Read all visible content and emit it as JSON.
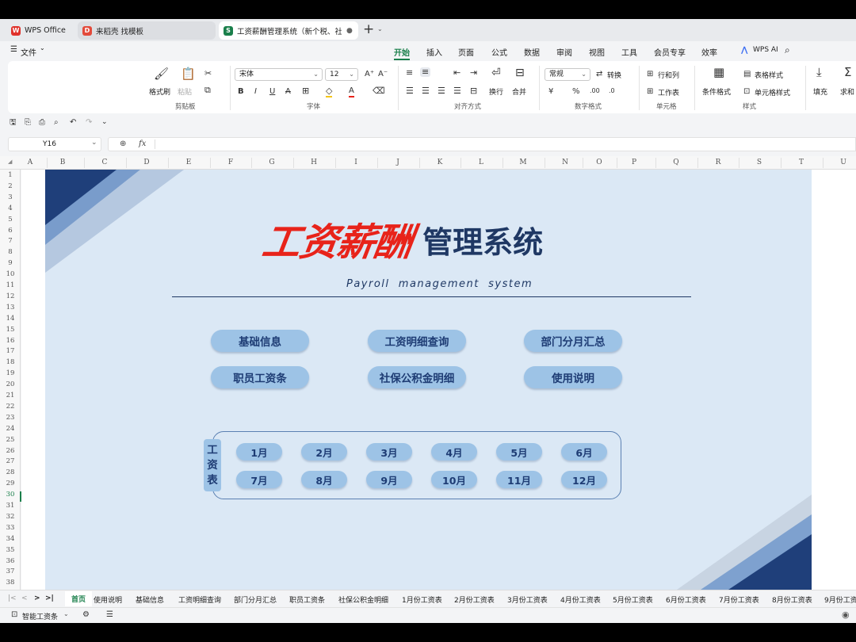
{
  "tabs": {
    "wps": "WPS Office",
    "templates": "来稻壳 找模板",
    "doc": "工资薪酬管理系统（新个税、社保",
    "add": "+"
  },
  "menu": {
    "file": "文件",
    "items": [
      "开始",
      "插入",
      "页面",
      "公式",
      "数据",
      "审阅",
      "视图",
      "工具",
      "会员专享",
      "效率"
    ],
    "active": "开始",
    "wps_ai": "WPS AI"
  },
  "ribbon": {
    "format_painter": "格式刷",
    "paste": "粘贴",
    "clipboard": "剪贴板",
    "font_name": "宋体",
    "font_size": "12",
    "font_group": "字体",
    "wrap": "换行",
    "merge": "合并",
    "align_group": "对齐方式",
    "number_format": "常规",
    "convert": "转换",
    "number_group": "数字格式",
    "rows_cols": "行和列",
    "worksheet": "工作表",
    "cell_group": "单元格",
    "cond_format": "条件格式",
    "table_style": "表格样式",
    "cell_style": "单元格样式",
    "style_group": "样式",
    "fill": "填充",
    "sum": "求和"
  },
  "formula": {
    "cell_ref": "Y16",
    "fx": "fx"
  },
  "columns": [
    "A",
    "B",
    "C",
    "D",
    "E",
    "F",
    "G",
    "H",
    "I",
    "J",
    "K",
    "L",
    "M",
    "N",
    "O",
    "P",
    "Q",
    "R",
    "S",
    "T",
    "U"
  ],
  "rows": [
    "1",
    "2",
    "3",
    "4",
    "5",
    "6",
    "7",
    "8",
    "9",
    "10",
    "11",
    "12",
    "13",
    "14",
    "15",
    "16",
    "17",
    "18",
    "19",
    "20",
    "21",
    "22",
    "23",
    "24",
    "25",
    "26",
    "27",
    "28",
    "29",
    "30",
    "31",
    "32",
    "33",
    "34",
    "35",
    "36",
    "37",
    "38"
  ],
  "banner": {
    "title_red": "工资薪酬",
    "title_navy": "管理系统",
    "subtitle": "Payroll  management  system"
  },
  "nav_buttons": [
    "基础信息",
    "工资明细查询",
    "部门分月汇总",
    "职员工资条",
    "社保公积金明细",
    "使用说明"
  ],
  "payroll": {
    "label": [
      "工",
      "资",
      "表"
    ],
    "months": [
      "1月",
      "2月",
      "3月",
      "4月",
      "5月",
      "6月",
      "7月",
      "8月",
      "9月",
      "10月",
      "11月",
      "12月"
    ]
  },
  "sheet_tabs": [
    "首页",
    "使用说明",
    "基础信息",
    "工资明细查询",
    "部门分月汇总",
    "职员工资条",
    "社保公积金明细",
    "1月份工资表",
    "2月份工资表",
    "3月份工资表",
    "4月份工资表",
    "5月份工资表",
    "6月份工资表",
    "7月份工资表",
    "8月份工资表",
    "9月份工资"
  ],
  "active_sheet": "首页",
  "status": {
    "mode": "智能工资条"
  },
  "colors": {
    "accent_green": "#1a7f4b",
    "title_red": "#e8231a",
    "navy": "#1f3864",
    "pill": "#9dc3e6",
    "canvas": "#dbe8f5"
  }
}
